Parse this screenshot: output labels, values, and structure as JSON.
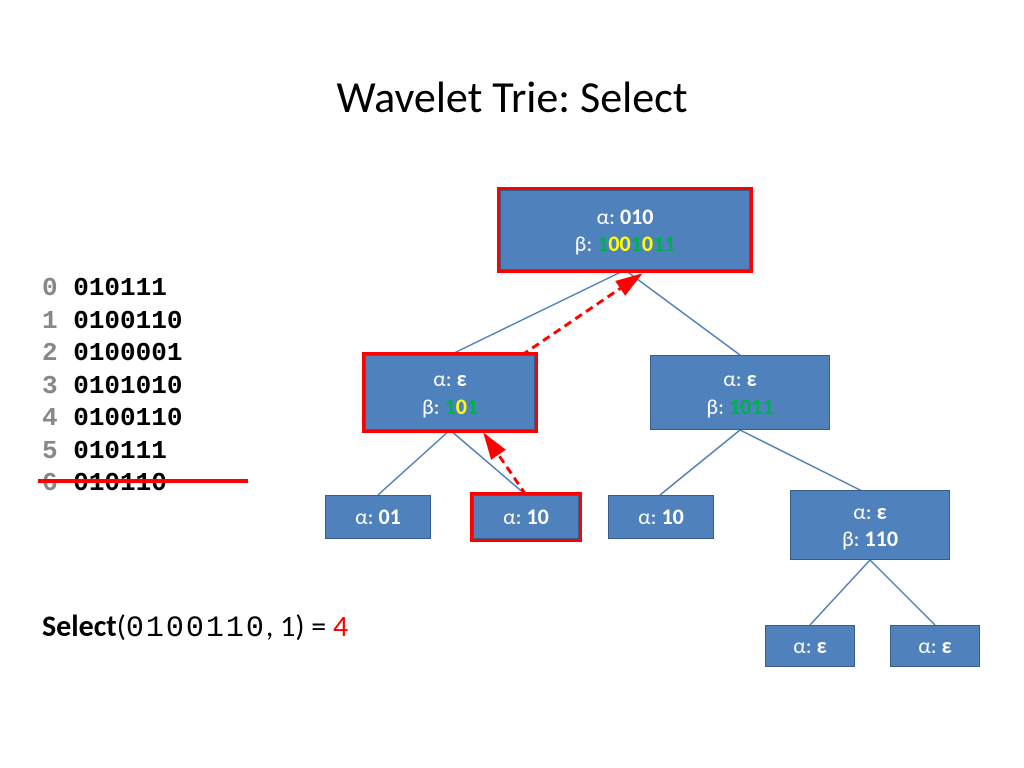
{
  "title": "Wavelet Trie: Select",
  "sequences": [
    {
      "idx": "0",
      "val": "010111"
    },
    {
      "idx": "1",
      "val": "0100110"
    },
    {
      "idx": "2",
      "val": "0100001"
    },
    {
      "idx": "3",
      "val": "0101010"
    },
    {
      "idx": "4",
      "val": "0100110"
    },
    {
      "idx": "5",
      "val": "010111"
    },
    {
      "idx": "6",
      "val": "010110"
    }
  ],
  "query": {
    "fn": "Select",
    "open": "(",
    "arg1": "0100110",
    "sep": ", 1) = ",
    "result": "4"
  },
  "nodes": {
    "root": {
      "alpha_label": "α: ",
      "alpha": "010",
      "beta_label": "β: ",
      "beta_parts": [
        {
          "t": "1",
          "c": "green"
        },
        {
          "t": "00",
          "c": "yellow"
        },
        {
          "t": "1",
          "c": "green"
        },
        {
          "t": "0",
          "c": "yellow"
        },
        {
          "t": "11",
          "c": "green"
        }
      ]
    },
    "left": {
      "alpha_label": "α: ",
      "alpha": "ε",
      "beta_label": "β: ",
      "beta_parts": [
        {
          "t": "1",
          "c": "green"
        },
        {
          "t": "0",
          "c": "yellow"
        },
        {
          "t": "1",
          "c": "green"
        }
      ]
    },
    "right": {
      "alpha_label": "α: ",
      "alpha": "ε",
      "beta_label": "β: ",
      "beta_parts": [
        {
          "t": "1011",
          "c": "green"
        }
      ]
    },
    "ll": {
      "alpha_label": "α: ",
      "alpha": "01"
    },
    "lr": {
      "alpha_label": "α: ",
      "alpha": "10"
    },
    "rl": {
      "alpha_label": "α: ",
      "alpha": "10"
    },
    "rr": {
      "alpha_label": "α: ",
      "alpha": "ε",
      "beta_label": "β: ",
      "beta": "110"
    },
    "rrl": {
      "alpha_label": "α: ",
      "alpha": "ε"
    },
    "rrr": {
      "alpha_label": "α: ",
      "alpha": "ε"
    }
  }
}
